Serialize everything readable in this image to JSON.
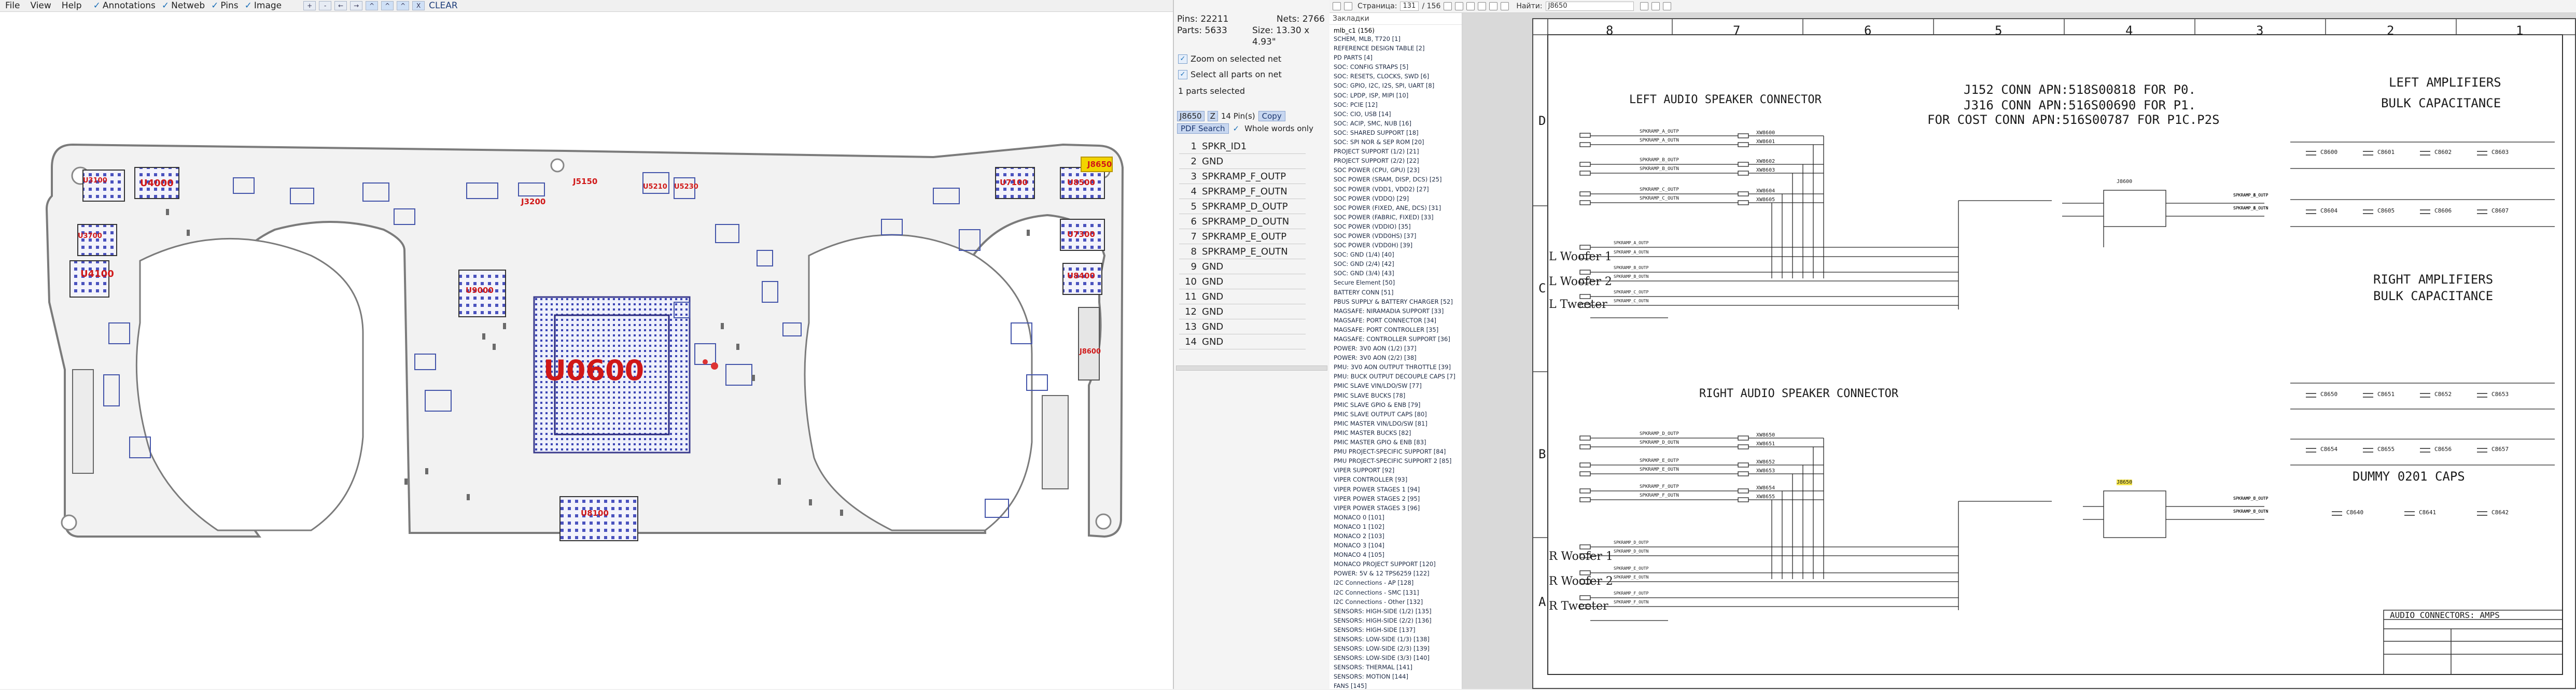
{
  "menu": {
    "file": "File",
    "view": "View",
    "help": "Help",
    "annotations": "Annotations",
    "netweb": "Netweb",
    "pins": "Pins",
    "image": "Image",
    "clear": "CLEAR",
    "nav_buttons": [
      "+",
      "-",
      "←",
      "→",
      "^",
      "^",
      "^",
      "X"
    ]
  },
  "board": {
    "parts": [
      {
        "label": "U0600",
        "size": "xl"
      },
      {
        "label": "U9000",
        "size": "m"
      },
      {
        "label": "U8100",
        "size": "m"
      },
      {
        "label": "U4000",
        "size": "m"
      },
      {
        "label": "U4100",
        "size": "m"
      },
      {
        "label": "U7100",
        "size": "m"
      },
      {
        "label": "U7300",
        "size": "m"
      },
      {
        "label": "U8400",
        "size": "m"
      },
      {
        "label": "U8500",
        "size": "m"
      },
      {
        "label": "J8600",
        "size": "s"
      },
      {
        "label": "J8650",
        "size": "s"
      },
      {
        "label": "J3200",
        "size": "s"
      },
      {
        "label": "J5150",
        "size": "s"
      },
      {
        "label": "U5210",
        "size": "s"
      },
      {
        "label": "U5230",
        "size": "s"
      },
      {
        "label": "U3100",
        "size": "s"
      },
      {
        "label": "U3700",
        "size": "s"
      }
    ],
    "highlight": "J8650"
  },
  "panel": {
    "pins_label": "Pins: 22211",
    "nets_label": "Nets: 2766",
    "parts_label": "Parts: 5633",
    "size_label": "Size: 13.30 x 4.93\"",
    "zoom_option": "Zoom on selected net",
    "select_option": "Select all parts on net",
    "selected_count": "1 parts selected",
    "net_part": "J8650",
    "net_side": "Z",
    "pin_count": "14 Pin(s)",
    "copy": "Copy",
    "pdf_search": "PDF Search",
    "whole_words": "Whole words only",
    "pins": [
      {
        "n": "1",
        "net": "SPKR_ID1"
      },
      {
        "n": "2",
        "net": "GND"
      },
      {
        "n": "3",
        "net": "SPKRAMP_F_OUTP"
      },
      {
        "n": "4",
        "net": "SPKRAMP_F_OUTN"
      },
      {
        "n": "5",
        "net": "SPKRAMP_D_OUTP"
      },
      {
        "n": "6",
        "net": "SPKRAMP_D_OUTN"
      },
      {
        "n": "7",
        "net": "SPKRAMP_E_OUTP"
      },
      {
        "n": "8",
        "net": "SPKRAMP_E_OUTN"
      },
      {
        "n": "9",
        "net": "GND"
      },
      {
        "n": "10",
        "net": "GND"
      },
      {
        "n": "11",
        "net": "GND"
      },
      {
        "n": "12",
        "net": "GND"
      },
      {
        "n": "13",
        "net": "GND"
      },
      {
        "n": "14",
        "net": "GND"
      }
    ]
  },
  "viewer": {
    "page_label": "Страница:",
    "page_value": "131",
    "page_total": "/ 156",
    "find_label": "Найти:",
    "find_value": "J8650"
  },
  "bookmarks": {
    "title": "Закладки",
    "root": "mlb_c1 (156)",
    "items": [
      "SCHEM, MLB, T720 [1]",
      "REFERENCE DESIGN TABLE [2]",
      "PD PARTS [4]",
      "SOC: CONFIG STRAPS [5]",
      "SOC: RESETS, CLOCKS, SWD [6]",
      "SOC: GPIO, I2C, I2S, SPI, UART [8]",
      "SOC: LPDP, ISP, MIPI [10]",
      "SOC: PCIE [12]",
      "SOC: CIO, USB [14]",
      "SOC: ACIP, SMC, NUB [16]",
      "SOC: SHARED SUPPORT [18]",
      "SOC: SPI NOR & SEP ROM [20]",
      "PROJECT SUPPORT (1/2) [21]",
      "PROJECT SUPPORT (2/2) [22]",
      "SOC POWER (CPU, GPU) [23]",
      "SOC POWER (SRAM, DISP, DCS) [25]",
      "SOC POWER (VDD1, VDD2) [27]",
      "SOC POWER (VDDQ) [29]",
      "SOC POWER (FIXED, ANE, DCS) [31]",
      "SOC POWER (FABRIC, FIXED) [33]",
      "SOC POWER (VDDIO) [35]",
      "SOC POWER (VDD0HS) [37]",
      "SOC POWER (VDD0H) [39]",
      "SOC: GND (1/4) [40]",
      "SOC: GND (2/4) [42]",
      "SOC: GND (3/4) [43]",
      "Secure Element [50]",
      "BATTERY CONN [51]",
      "PBUS SUPPLY & BATTERY CHARGER [52]",
      "MAGSAFE: NIRAMADIA SUPPORT [33]",
      "MAGSAFE: PORT CONNECTOR [34]",
      "MAGSAFE: PORT CONTROLLER [35]",
      "MAGSAFE: CONTROLLER SUPPORT [36]",
      "POWER: 3V0 AON (1/2) [37]",
      "POWER: 3V0 AON (2/2) [38]",
      "PMU: 3V0 AON OUTPUT THROTTLE [39]",
      "PMU: BUCK OUTPUT DECOUPLE CAPS [7]",
      "PMIC SLAVE VIN/LDO/SW [77]",
      "PMIC SLAVE BUCKS [78]",
      "PMIC SLAVE GPIO & ENB [79]",
      "PMIC SLAVE OUTPUT CAPS [80]",
      "PMIC MASTER VIN/LDO/SW [81]",
      "PMIC MASTER BUCKS [82]",
      "PMIC MASTER GPIO & ENB [83]",
      "PMU PROJECT-SPECIFIC SUPPORT [84]",
      "PMU PROJECT-SPECIFIC SUPPORT 2 [85]",
      "VIPER SUPPORT [92]",
      "VIPER CONTROLLER [93]",
      "VIPER POWER STAGES 1 [94]",
      "VIPER POWER STAGES 2 [95]",
      "VIPER POWER STAGES 3 [96]",
      "MONACO 0 [101]",
      "MONACO 1 [102]",
      "MONACO 2 [103]",
      "MONACO 3 [104]",
      "MONACO 4 [105]",
      "MONACO PROJECT SUPPORT [120]",
      "POWER: 5V & 12 TPS6259 [122]",
      "I2C Connections - AP [128]",
      "I2C Connections - SMC [131]",
      "I2C Connections - Other [132]",
      "SENSORS: HIGH-SIDE (1/2) [135]",
      "SENSORS: HIGH-SIDE (2/2) [136]",
      "SENSORS: HIGH-SIDE [137]",
      "SENSORS: LOW-SIDE (1/3) [138]",
      "SENSORS: LOW-SIDE (2/3) [139]",
      "SENSORS: LOW-SIDE (3/3) [140]",
      "SENSORS: THERMAL [141]",
      "SENSORS: MOTION [144]",
      "FANS [145]"
    ]
  },
  "schematic": {
    "cols": [
      "8",
      "7",
      "6",
      "5",
      "4",
      "3",
      "2",
      "1"
    ],
    "rows": [
      "D",
      "C",
      "B",
      "A"
    ],
    "left_title": "LEFT AUDIO SPEAKER CONNECTOR",
    "right_title": "RIGHT AUDIO SPEAKER CONNECTOR",
    "conn_line1": "J152 CONN APN:518S00818 FOR P0.",
    "conn_line2": "J316 CONN APN:516S00690 FOR P1.",
    "conn_line3": "FOR COST CONN APN:516S00787 FOR P1C.P2S",
    "left_amp_1": "LEFT AMPLIFIERS",
    "left_amp_2": "BULK CAPACITANCE",
    "right_amp_1": "RIGHT AMPLIFIERS",
    "right_amp_2": "BULK CAPACITANCE",
    "dummy_caps": "DUMMY 0201 CAPS",
    "l_woofer1": "L Woofer 1",
    "l_woofer2": "L Woofer 2",
    "l_tweeter": "L Tweeter",
    "r_woofer1": "R Woofer 1",
    "r_woofer2": "R Woofer 2",
    "r_tweeter": "R Tweeter",
    "sheet_title": "AUDIO CONNECTORS: AMPS",
    "conn_ref_top": "J8600",
    "conn_ref_bottom": "J8650",
    "nets": [
      "SPKRAMP_A_OUTP",
      "SPKRAMP_A_OUTN",
      "SPKRAMP_B_OUTP",
      "SPKRAMP_B_OUTN",
      "SPKRAMP_C_OUTP",
      "SPKRAMP_C_OUTN",
      "SPKRAMP_D_OUTP",
      "SPKRAMP_D_OUTN",
      "SPKRAMP_E_OUTP",
      "SPKRAMP_E_OUTN",
      "SPKRAMP_F_OUTP",
      "SPKRAMP_F_OUTN"
    ],
    "left_resistors": [
      "XW8600",
      "XW8601",
      "XW8602",
      "XW8603",
      "XW8604",
      "XW8605"
    ],
    "right_resistors": [
      "XW8650",
      "XW8651",
      "XW8652",
      "XW8653",
      "XW8654",
      "XW8655"
    ],
    "left_caps_a": [
      "C8600",
      "C8601",
      "C8602",
      "C8603"
    ],
    "left_caps_b": [
      "C8604",
      "C8605",
      "C8606",
      "C8607"
    ],
    "right_caps_a": [
      "C8650",
      "C8651",
      "C8652",
      "C8653"
    ],
    "right_caps_b": [
      "C8654",
      "C8655",
      "C8656",
      "C8657"
    ],
    "dummy_refs": [
      "C8640",
      "C8641",
      "C8642"
    ]
  }
}
